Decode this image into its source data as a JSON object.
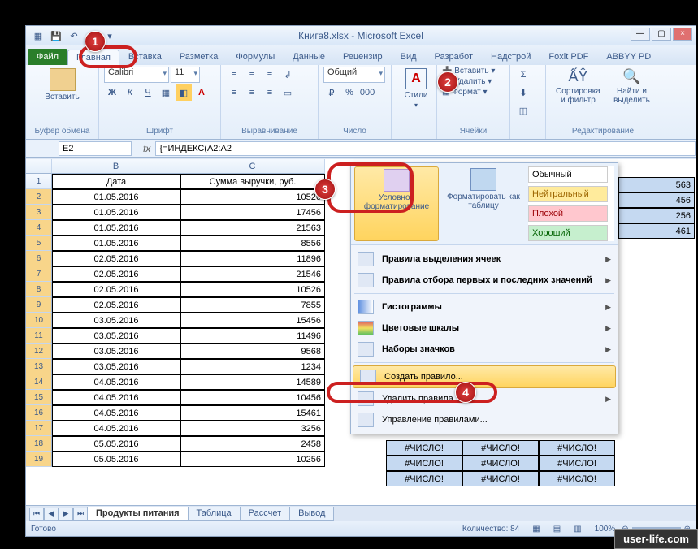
{
  "title": "Книга8.xlsx - Microsoft Excel",
  "tabs": {
    "file": "Файл",
    "home": "Главная",
    "insert": "Вставка",
    "layout": "Разметка",
    "formulas": "Формулы",
    "data": "Данные",
    "review": "Рецензир",
    "view": "Вид",
    "dev": "Разработ",
    "addin": "Надстрой",
    "foxit": "Foxit PDF",
    "abbyy": "ABBYY PD"
  },
  "ribbon": {
    "paste": "Вставить",
    "clipboard": "Буфер обмена",
    "font_name": "Calibri",
    "font_size": "11",
    "font_group": "Шрифт",
    "align_group": "Выравнивание",
    "number_format": "Общий",
    "number_group": "Число",
    "styles": "Стили",
    "cells_group": "Ячейки",
    "insert_btn": "Вставить",
    "delete_btn": "Удалить",
    "format_btn": "Формат",
    "sort": "Сортировка и фильтр",
    "find": "Найти и выделить",
    "edit_group": "Редактирование"
  },
  "namebox": "E2",
  "formula": "{=ИНДЕКС(A2:A2",
  "columns": {
    "B": "Дата",
    "C": "Сумма выручки, руб."
  },
  "table": [
    {
      "n": "1",
      "date": "Дата",
      "val": "Сумма выручки, руб.",
      "hdr": true
    },
    {
      "n": "2",
      "date": "01.05.2016",
      "val": "10526"
    },
    {
      "n": "3",
      "date": "01.05.2016",
      "val": "17456"
    },
    {
      "n": "4",
      "date": "01.05.2016",
      "val": "21563"
    },
    {
      "n": "5",
      "date": "01.05.2016",
      "val": "8556"
    },
    {
      "n": "6",
      "date": "02.05.2016",
      "val": "11896"
    },
    {
      "n": "7",
      "date": "02.05.2016",
      "val": "21546"
    },
    {
      "n": "8",
      "date": "02.05.2016",
      "val": "10526"
    },
    {
      "n": "9",
      "date": "02.05.2016",
      "val": "7855"
    },
    {
      "n": "10",
      "date": "03.05.2016",
      "val": "15456"
    },
    {
      "n": "11",
      "date": "03.05.2016",
      "val": "11496"
    },
    {
      "n": "12",
      "date": "03.05.2016",
      "val": "9568"
    },
    {
      "n": "13",
      "date": "03.05.2016",
      "val": "1234"
    },
    {
      "n": "14",
      "date": "04.05.2016",
      "val": "14589"
    },
    {
      "n": "15",
      "date": "04.05.2016",
      "val": "10456"
    },
    {
      "n": "16",
      "date": "04.05.2016",
      "val": "15461"
    },
    {
      "n": "17",
      "date": "04.05.2016",
      "val": "3256"
    },
    {
      "n": "18",
      "date": "05.05.2016",
      "val": "2458"
    },
    {
      "n": "19",
      "date": "05.05.2016",
      "val": "10256"
    }
  ],
  "peek_vals": [
    "563",
    "456",
    "256",
    "461"
  ],
  "error_text": "#ЧИСЛО!",
  "dropdown": {
    "cond_fmt": "Условное форматирование",
    "fmt_table": "Форматировать как таблицу",
    "cell_styles": {
      "normal": "Обычный",
      "neutral": "Нейтральный",
      "bad": "Плохой",
      "good": "Хороший"
    },
    "rules_highlight": "Правила выделения ячеек",
    "rules_topbottom": "Правила отбора первых и последних значений",
    "databars": "Гистограммы",
    "colorscales": "Цветовые шкалы",
    "iconsets": "Наборы значков",
    "new_rule": "Создать правило...",
    "clear_rules": "Удалить правила",
    "manage_rules": "Управление правилами..."
  },
  "sheets": {
    "s1": "Продукты питания",
    "s2": "Таблица",
    "s3": "Рассчет",
    "s4": "Вывод"
  },
  "status": {
    "ready": "Готово",
    "count": "Количество: 84",
    "zoom": "100%"
  },
  "watermark": "user-life.com"
}
